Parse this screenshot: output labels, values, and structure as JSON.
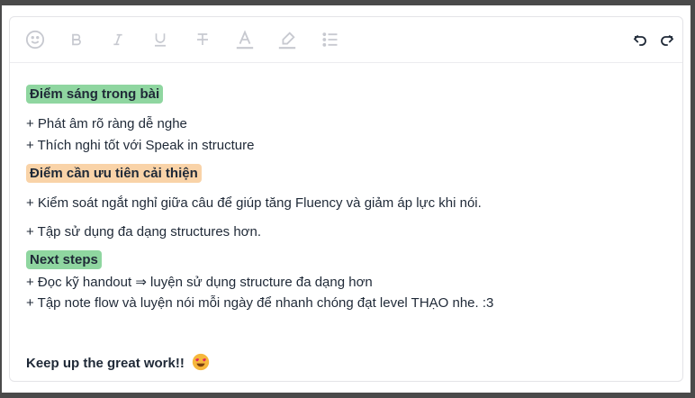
{
  "toolbar": {
    "items": [
      {
        "name": "emoji-icon"
      },
      {
        "name": "bold-icon"
      },
      {
        "name": "italic-icon"
      },
      {
        "name": "underline-icon"
      },
      {
        "name": "strikethrough-icon"
      },
      {
        "name": "text-color-icon"
      },
      {
        "name": "highlight-icon"
      },
      {
        "name": "bullet-list-icon"
      },
      {
        "name": "undo-icon"
      },
      {
        "name": "redo-icon"
      }
    ]
  },
  "content": {
    "highlights_heading": "Điểm sáng trong bài",
    "highlights": [
      "+ Phát âm rõ ràng dễ nghe",
      "+ Thích nghi tốt với Speak in structure"
    ],
    "improve_heading": "Điểm cần ưu tiên cải thiện",
    "improve": [
      "+ Kiểm soát ngắt nghỉ giữa câu để giúp tăng Fluency và giảm áp lực khi nói.",
      "+ Tập sử dụng đa dạng structures hơn."
    ],
    "next_heading": "Next steps",
    "next": [
      "+ Đọc kỹ handout ⇒ luyện sử dụng structure đa dạng hơn",
      "+ Tập note flow và luyện nói mỗi ngày để nhanh chóng đạt level THẠO nhe. :3"
    ],
    "closing": "Keep up the great work!!",
    "closing_emoji": "smiling-face-with-heart-eyes-icon"
  },
  "colors": {
    "tag_green": "#8fd6a0",
    "tag_orange": "#f9d3a8",
    "icon_inactive": "#c7c9d0",
    "icon_active": "#1f2937"
  }
}
